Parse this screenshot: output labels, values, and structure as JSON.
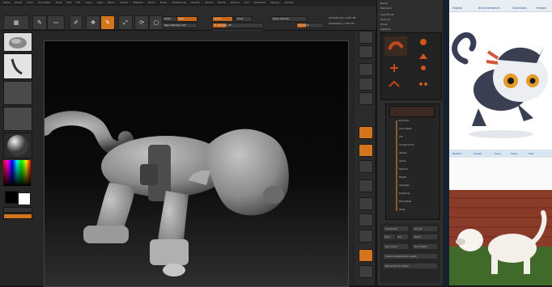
{
  "menubar": {
    "items": [
      "Alpha",
      "Brush",
      "Color",
      "Document",
      "Draw",
      "Edit",
      "File",
      "Layer",
      "Light",
      "Macro",
      "Marker",
      "Material",
      "Movie",
      "Picker",
      "Preferences",
      "Render",
      "Stencil",
      "Stroke",
      "Texture",
      "Tool",
      "Transform",
      "Zplugin",
      "Zscript"
    ]
  },
  "toolbar": {
    "edit_label": "Edit",
    "draw_label": "Draw",
    "move_label": "Move",
    "scale_label": "Scale",
    "rotate_label": "Rotate",
    "mrgb_label": "Mrgb",
    "rgb_label": "Rgb",
    "m_label": "M",
    "zadd_label": "Zadd",
    "zsub_label": "Zsub",
    "zcut_label": "Zcut",
    "focal_label": "Focal Shift 0",
    "draw_size_label": "Draw Size 64",
    "z_intensity_label": "Z Intensity 25",
    "rgb_intensity_label": "Rgb Intensity 100",
    "active_points_label": "ActivePoints: 1.007 Mil",
    "total_points_label": "TotalPoints: 1.007 Mil",
    "dynamic_label": "Dynamic"
  },
  "palette": {
    "title": "Brush",
    "subtitle": "Standard",
    "rows": [
      "Load Brush",
      "Save As",
      "Clone",
      "Lightbox",
      "Brushes",
      "Auto Mask",
      "Tilt",
      "Sculptris Pro",
      "Stroke",
      "Alpha",
      "Texture",
      "Depth",
      "Samples",
      "Elasticity",
      "FiberMesh",
      "Twist",
      "Orientation",
      "Surface",
      "Modifiers",
      "Smooth"
    ],
    "bottom_rows": [
      "Subdivide",
      "Divide",
      "Smt",
      "Suv",
      "ReUV",
      "Del Lower",
      "Del Higher",
      "Freeze SubDivision Levels",
      "Reconstruct Subdiv"
    ]
  },
  "browser": {
    "tabs": [
      "Explore",
      "#cute #creature",
      "Collections",
      "Images"
    ],
    "bar_items": [
      "Related",
      "Similar",
      "Save",
      "Share",
      "Visit"
    ]
  },
  "colors": {
    "accent": "#d4741d",
    "bg": "#1a1a1a",
    "panel": "#2e2e2e"
  }
}
